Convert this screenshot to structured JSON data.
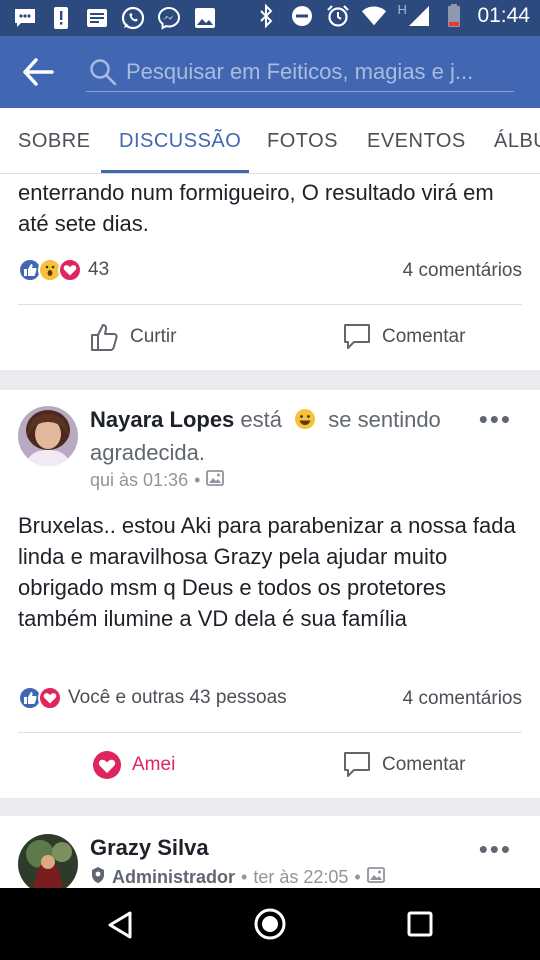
{
  "status_bar": {
    "time": "01:44",
    "network_letter": "H",
    "icons": [
      "chat-bubble-icon",
      "alert-icon",
      "news-icon",
      "whatsapp-icon",
      "messenger-icon",
      "image-icon",
      "bluetooth-icon",
      "do-not-disturb-icon",
      "alarm-icon",
      "wifi-icon",
      "signal-icon",
      "battery-icon"
    ]
  },
  "app_bar": {
    "search_placeholder": "Pesquisar em Feiticos, magias e j..."
  },
  "tabs": [
    "SOBRE",
    "DISCUSSÃO",
    "FOTOS",
    "EVENTOS",
    "ÁLBU"
  ],
  "active_tab": "DISCUSSÃO",
  "post1": {
    "text": "enterrando num formigueiro, O resultado virá em até sete dias.",
    "reaction_icons": [
      "like-icon",
      "wow-icon",
      "love-icon"
    ],
    "reaction_count": "43",
    "comments": "4 comentários",
    "like_label": "Curtir",
    "comment_label": "Comentar"
  },
  "post2": {
    "author": "Nayara Lopes",
    "feeling_prefix": "está",
    "feeling_text": "se sentindo agradecida.",
    "time": "qui às 01:36",
    "text": "Bruxelas.. estou Aki para parabenizar a nossa fada linda e maravilhosa Grazy pela ajudar muito obrigado msm q Deus e todos os protetores também ilumine a VD dela é sua família",
    "reactions_text": "Você e outras 43 pessoas",
    "comments": "4 comentários",
    "love_label": "Amei",
    "comment_label": "Comentar"
  },
  "post3": {
    "author": "Grazy Silva",
    "role": "Administrador",
    "time": "ter às 22:05"
  },
  "colors": {
    "status_bar": "#2d4a7e",
    "app_bar": "#4267b2",
    "like_blue": "#4267b2",
    "love_red": "#e0245e",
    "text": "#1d2129",
    "secondary": "#90949c"
  }
}
